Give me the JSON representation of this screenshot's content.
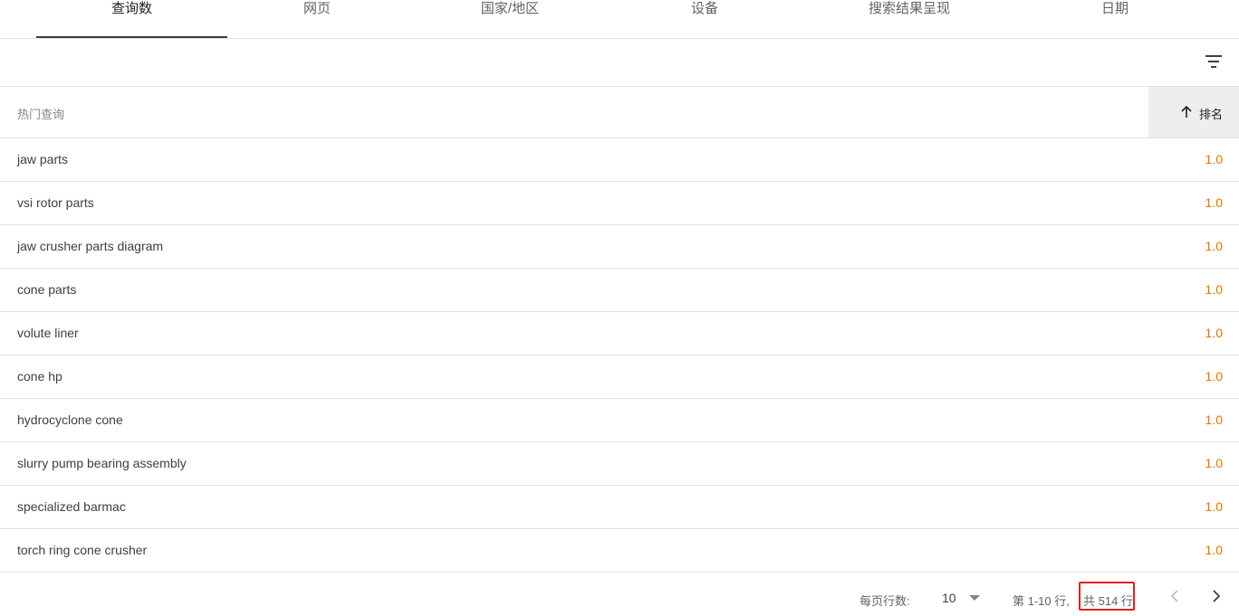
{
  "tabs": [
    {
      "label": "查询数",
      "active": true
    },
    {
      "label": "网页",
      "active": false
    },
    {
      "label": "国家/地区",
      "active": false
    },
    {
      "label": "设备",
      "active": false
    },
    {
      "label": "搜索结果呈现",
      "active": false
    },
    {
      "label": "日期",
      "active": false
    }
  ],
  "filter": {
    "icon": "filter-list-icon"
  },
  "table": {
    "columns": {
      "query": "热门查询",
      "rank": "排名"
    },
    "sort": {
      "icon": "arrow-up-icon",
      "direction": "ascending"
    },
    "rows": [
      {
        "query": "jaw parts",
        "rank": "1.0"
      },
      {
        "query": "vsi rotor parts",
        "rank": "1.0"
      },
      {
        "query": "jaw crusher parts diagram",
        "rank": "1.0"
      },
      {
        "query": "cone parts",
        "rank": "1.0"
      },
      {
        "query": "volute liner",
        "rank": "1.0"
      },
      {
        "query": "cone hp",
        "rank": "1.0"
      },
      {
        "query": "hydrocyclone cone",
        "rank": "1.0"
      },
      {
        "query": "slurry pump bearing assembly",
        "rank": "1.0"
      },
      {
        "query": "specialized barmac",
        "rank": "1.0"
      },
      {
        "query": "torch ring cone crusher",
        "rank": "1.0"
      }
    ]
  },
  "pagination": {
    "rows_per_page_label": "每页行数:",
    "rows_per_page_value": "10",
    "range_label": "第 1-10 行,",
    "total_label": "共 514 行",
    "prev_icon": "chevron-left-icon",
    "next_icon": "chevron-right-icon"
  },
  "colors": {
    "accent_value": "#e37400",
    "highlight_box": "#e02020",
    "sorted_header_bg": "#eeeeee"
  }
}
